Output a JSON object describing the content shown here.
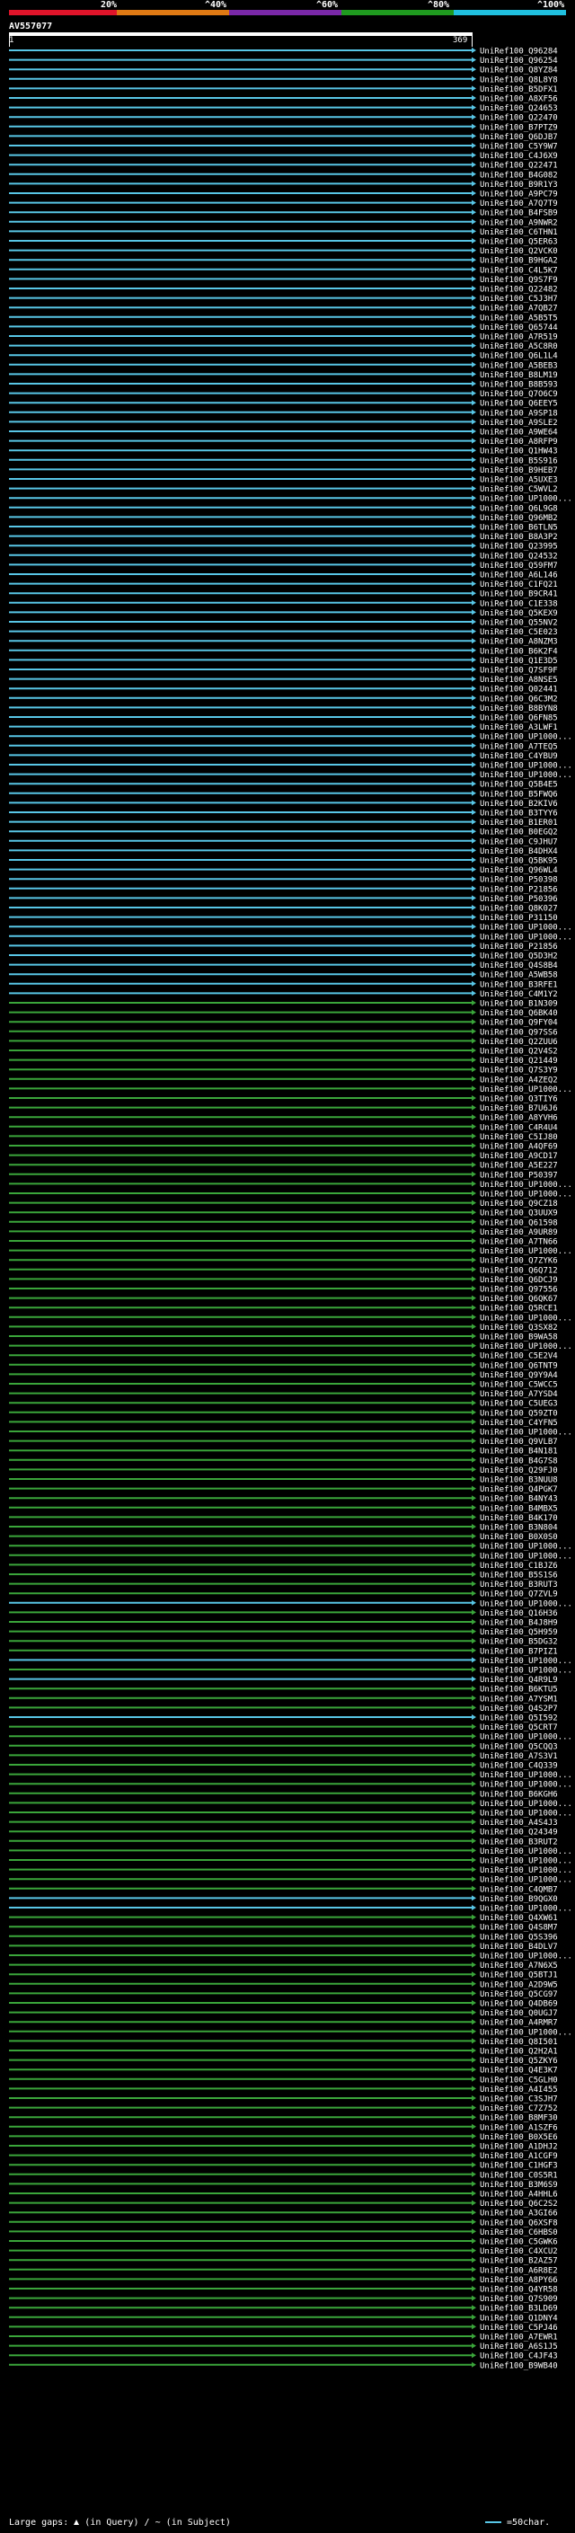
{
  "colors": {
    "scale_segments": [
      "#e0142a",
      "#e07a14",
      "#7a28a8",
      "#1f9a1f",
      "#20c0e0"
    ],
    "hit_high": "#58c6e6",
    "hit_mid": "#3aa53a",
    "marker": "#ffffff",
    "label": "#ffffff"
  },
  "scale": {
    "labels": [
      "20%",
      "^40%",
      "^60%",
      "^80%",
      "^100%"
    ]
  },
  "query": {
    "title": "AV557077",
    "start": "1",
    "end": "369"
  },
  "chart_data": {
    "type": "alignment-overview",
    "query_length": 369,
    "hits": [
      {
        "id": "UniRef100_Q96284",
        "identity": "high"
      },
      {
        "id": "UniRef100_Q96254",
        "identity": "high"
      },
      {
        "id": "UniRef100_Q8YZ84",
        "identity": "high"
      },
      {
        "id": "UniRef100_Q8L8Y8",
        "identity": "high"
      },
      {
        "id": "UniRef100_B5DFX1",
        "identity": "high"
      },
      {
        "id": "UniRef100_A8XF56",
        "identity": "high"
      },
      {
        "id": "UniRef100_Q24653",
        "identity": "high"
      },
      {
        "id": "UniRef100_Q22470",
        "identity": "high"
      },
      {
        "id": "UniRef100_B7PTZ9",
        "identity": "high"
      },
      {
        "id": "UniRef100_Q6DJB7",
        "identity": "high"
      },
      {
        "id": "UniRef100_C5Y9W7",
        "identity": "high"
      },
      {
        "id": "UniRef100_C4J6X9",
        "identity": "high"
      },
      {
        "id": "UniRef100_Q22471",
        "identity": "high"
      },
      {
        "id": "UniRef100_B4G082",
        "identity": "high"
      },
      {
        "id": "UniRef100_B9R1Y3",
        "identity": "high"
      },
      {
        "id": "UniRef100_A9PC79",
        "identity": "high"
      },
      {
        "id": "UniRef100_A7Q7T9",
        "identity": "high"
      },
      {
        "id": "UniRef100_B4FSB9",
        "identity": "high"
      },
      {
        "id": "UniRef100_A9NWR2",
        "identity": "high"
      },
      {
        "id": "UniRef100_C6THN1",
        "identity": "high"
      },
      {
        "id": "UniRef100_Q5ER63",
        "identity": "high"
      },
      {
        "id": "UniRef100_Q2VCK0",
        "identity": "high"
      },
      {
        "id": "UniRef100_B9HGA2",
        "identity": "high"
      },
      {
        "id": "UniRef100_C4L5K7",
        "identity": "high"
      },
      {
        "id": "UniRef100_Q9S7F9",
        "identity": "high"
      },
      {
        "id": "UniRef100_Q22482",
        "identity": "high"
      },
      {
        "id": "UniRef100_C5J3H7",
        "identity": "high"
      },
      {
        "id": "UniRef100_A7QB27",
        "identity": "high"
      },
      {
        "id": "UniRef100_A5B5T5",
        "identity": "high"
      },
      {
        "id": "UniRef100_Q65744",
        "identity": "high"
      },
      {
        "id": "UniRef100_A7R519",
        "identity": "high"
      },
      {
        "id": "UniRef100_A5C8R0",
        "identity": "high"
      },
      {
        "id": "UniRef100_Q6L1L4",
        "identity": "high"
      },
      {
        "id": "UniRef100_A5BEB3",
        "identity": "high"
      },
      {
        "id": "UniRef100_B8LM19",
        "identity": "high"
      },
      {
        "id": "UniRef100_B8B593",
        "identity": "high"
      },
      {
        "id": "UniRef100_Q7O6C9",
        "identity": "high"
      },
      {
        "id": "UniRef100_Q6EEY5",
        "identity": "high"
      },
      {
        "id": "UniRef100_A9SP18",
        "identity": "high"
      },
      {
        "id": "UniRef100_A9SLE2",
        "identity": "high"
      },
      {
        "id": "UniRef100_A9WE64",
        "identity": "high"
      },
      {
        "id": "UniRef100_A8RFP9",
        "identity": "high"
      },
      {
        "id": "UniRef100_Q1HW43",
        "identity": "high"
      },
      {
        "id": "UniRef100_B5S916",
        "identity": "high"
      },
      {
        "id": "UniRef100_B9HEB7",
        "identity": "high"
      },
      {
        "id": "UniRef100_A5UXE3",
        "identity": "high"
      },
      {
        "id": "UniRef100_C5WVL2",
        "identity": "high"
      },
      {
        "id": "UniRef100_UP1000...",
        "identity": "high"
      },
      {
        "id": "UniRef100_Q6L9G8",
        "identity": "high"
      },
      {
        "id": "UniRef100_Q96MB2",
        "identity": "high"
      },
      {
        "id": "UniRef100_B6TLN5",
        "identity": "high"
      },
      {
        "id": "UniRef100_B8A3P2",
        "identity": "high"
      },
      {
        "id": "UniRef100_Q23995",
        "identity": "high"
      },
      {
        "id": "UniRef100_Q24532",
        "identity": "high"
      },
      {
        "id": "UniRef100_Q59FM7",
        "identity": "high"
      },
      {
        "id": "UniRef100_A6L146",
        "identity": "high"
      },
      {
        "id": "UniRef100_C1FQ21",
        "identity": "high"
      },
      {
        "id": "UniRef100_B9CR41",
        "identity": "high"
      },
      {
        "id": "UniRef100_C1E338",
        "identity": "high"
      },
      {
        "id": "UniRef100_Q5KEX9",
        "identity": "high"
      },
      {
        "id": "UniRef100_Q55NV2",
        "identity": "high"
      },
      {
        "id": "UniRef100_C5E023",
        "identity": "high"
      },
      {
        "id": "UniRef100_A8NZM3",
        "identity": "high"
      },
      {
        "id": "UniRef100_B6K2F4",
        "identity": "high"
      },
      {
        "id": "UniRef100_Q1E3D5",
        "identity": "high"
      },
      {
        "id": "UniRef100_Q7SF9F",
        "identity": "high"
      },
      {
        "id": "UniRef100_A8NSE5",
        "identity": "high"
      },
      {
        "id": "UniRef100_Q02441",
        "identity": "high"
      },
      {
        "id": "UniRef100_Q6C3M2",
        "identity": "high"
      },
      {
        "id": "UniRef100_B8BYN8",
        "identity": "high"
      },
      {
        "id": "UniRef100_Q6FN85",
        "identity": "high"
      },
      {
        "id": "UniRef100_A3LWF1",
        "identity": "high"
      },
      {
        "id": "UniRef100_UP1000...",
        "identity": "high"
      },
      {
        "id": "UniRef100_A7TEQ5",
        "identity": "high"
      },
      {
        "id": "UniRef100_C4YBU9",
        "identity": "high"
      },
      {
        "id": "UniRef100_UP1000...",
        "identity": "high"
      },
      {
        "id": "UniRef100_UP1000...",
        "identity": "high"
      },
      {
        "id": "UniRef100_Q5B4E5",
        "identity": "high"
      },
      {
        "id": "UniRef100_B5FWQ6",
        "identity": "high"
      },
      {
        "id": "UniRef100_B2KIV6",
        "identity": "high"
      },
      {
        "id": "UniRef100_B3TYY6",
        "identity": "high"
      },
      {
        "id": "UniRef100_B1ER01",
        "identity": "high"
      },
      {
        "id": "UniRef100_B0EGQ2",
        "identity": "high"
      },
      {
        "id": "UniRef100_C9JHU7",
        "identity": "high"
      },
      {
        "id": "UniRef100_B4DHX4",
        "identity": "high"
      },
      {
        "id": "UniRef100_Q5BK95",
        "identity": "high"
      },
      {
        "id": "UniRef100_Q96WL4",
        "identity": "high"
      },
      {
        "id": "UniRef100_P50398",
        "identity": "high"
      },
      {
        "id": "UniRef100_P21856",
        "identity": "high"
      },
      {
        "id": "UniRef100_P50396",
        "identity": "high"
      },
      {
        "id": "UniRef100_Q8K027",
        "identity": "high"
      },
      {
        "id": "UniRef100_P31150",
        "identity": "high"
      },
      {
        "id": "UniRef100_UP1000...",
        "identity": "high"
      },
      {
        "id": "UniRef100_UP1000...",
        "identity": "high"
      },
      {
        "id": "UniRef100_P21856",
        "identity": "high"
      },
      {
        "id": "UniRef100_Q5D3H2",
        "identity": "high"
      },
      {
        "id": "UniRef100_Q4S8B4",
        "identity": "high"
      },
      {
        "id": "UniRef100_A5WB58",
        "identity": "high"
      },
      {
        "id": "UniRef100_B3RFE1",
        "identity": "high"
      },
      {
        "id": "UniRef100_C4M1Y2",
        "identity": "high"
      },
      {
        "id": "UniRef100_B1N309",
        "identity": "mid"
      },
      {
        "id": "UniRef100_Q6BK40",
        "identity": "mid"
      },
      {
        "id": "UniRef100_Q9FY04",
        "identity": "mid"
      },
      {
        "id": "UniRef100_Q97SS6",
        "identity": "mid"
      },
      {
        "id": "UniRef100_Q2ZUU6",
        "identity": "mid"
      },
      {
        "id": "UniRef100_Q2V4S2",
        "identity": "mid"
      },
      {
        "id": "UniRef100_Q21449",
        "identity": "mid"
      },
      {
        "id": "UniRef100_Q7S3Y9",
        "identity": "mid"
      },
      {
        "id": "UniRef100_A4ZEQ2",
        "identity": "mid"
      },
      {
        "id": "UniRef100_UP1000...",
        "identity": "mid"
      },
      {
        "id": "UniRef100_Q3TIY6",
        "identity": "mid"
      },
      {
        "id": "UniRef100_B7U6J6",
        "identity": "mid"
      },
      {
        "id": "UniRef100_A8YVH6",
        "identity": "mid"
      },
      {
        "id": "UniRef100_C4R4U4",
        "identity": "mid"
      },
      {
        "id": "UniRef100_C5IJ80",
        "identity": "mid"
      },
      {
        "id": "UniRef100_A4QF69",
        "identity": "mid"
      },
      {
        "id": "UniRef100_A9CD17",
        "identity": "mid"
      },
      {
        "id": "UniRef100_A5E227",
        "identity": "mid"
      },
      {
        "id": "UniRef100_P50397",
        "identity": "mid"
      },
      {
        "id": "UniRef100_UP1000...",
        "identity": "mid"
      },
      {
        "id": "UniRef100_UP1000...",
        "identity": "mid"
      },
      {
        "id": "UniRef100_Q9CZ18",
        "identity": "mid"
      },
      {
        "id": "UniRef100_Q3UUX9",
        "identity": "mid"
      },
      {
        "id": "UniRef100_Q61598",
        "identity": "mid"
      },
      {
        "id": "UniRef100_A9UR89",
        "identity": "mid"
      },
      {
        "id": "UniRef100_A7TN66",
        "identity": "mid"
      },
      {
        "id": "UniRef100_UP1000...",
        "identity": "mid"
      },
      {
        "id": "UniRef100_Q7ZYK6",
        "identity": "mid"
      },
      {
        "id": "UniRef100_Q6Q712",
        "identity": "mid"
      },
      {
        "id": "UniRef100_Q6DCJ9",
        "identity": "mid"
      },
      {
        "id": "UniRef100_Q97556",
        "identity": "mid"
      },
      {
        "id": "UniRef100_Q6QK67",
        "identity": "mid"
      },
      {
        "id": "UniRef100_Q5RCE1",
        "identity": "mid"
      },
      {
        "id": "UniRef100_UP1000...",
        "identity": "mid"
      },
      {
        "id": "UniRef100_Q3SX82",
        "identity": "mid"
      },
      {
        "id": "UniRef100_B9WA58",
        "identity": "mid"
      },
      {
        "id": "UniRef100_UP1000...",
        "identity": "mid"
      },
      {
        "id": "UniRef100_C5E2V4",
        "identity": "mid"
      },
      {
        "id": "UniRef100_Q6TNT9",
        "identity": "mid"
      },
      {
        "id": "UniRef100_Q9Y9A4",
        "identity": "mid"
      },
      {
        "id": "UniRef100_C5WCC5",
        "identity": "mid"
      },
      {
        "id": "UniRef100_A7YSD4",
        "identity": "mid"
      },
      {
        "id": "UniRef100_C5UEG3",
        "identity": "mid"
      },
      {
        "id": "UniRef100_Q59ZT0",
        "identity": "mid"
      },
      {
        "id": "UniRef100_C4YFN5",
        "identity": "mid"
      },
      {
        "id": "UniRef100_UP1000...",
        "identity": "mid"
      },
      {
        "id": "UniRef100_Q9VLB7",
        "identity": "mid"
      },
      {
        "id": "UniRef100_B4N181",
        "identity": "mid"
      },
      {
        "id": "UniRef100_B4G7S8",
        "identity": "mid"
      },
      {
        "id": "UniRef100_Q29FJ0",
        "identity": "mid"
      },
      {
        "id": "UniRef100_B3NUU8",
        "identity": "mid"
      },
      {
        "id": "UniRef100_Q4PGK7",
        "identity": "mid"
      },
      {
        "id": "UniRef100_B4NY43",
        "identity": "mid"
      },
      {
        "id": "UniRef100_B4MBX5",
        "identity": "mid"
      },
      {
        "id": "UniRef100_B4K170",
        "identity": "mid"
      },
      {
        "id": "UniRef100_B3N804",
        "identity": "mid"
      },
      {
        "id": "UniRef100_B0X0S0",
        "identity": "mid"
      },
      {
        "id": "UniRef100_UP1000...",
        "identity": "mid"
      },
      {
        "id": "UniRef100_UP1000...",
        "identity": "mid"
      },
      {
        "id": "UniRef100_C1BJZ6",
        "identity": "mid"
      },
      {
        "id": "UniRef100_B5S1S6",
        "identity": "mid"
      },
      {
        "id": "UniRef100_B3RUT3",
        "identity": "mid"
      },
      {
        "id": "UniRef100_Q7ZVL9",
        "identity": "mid"
      },
      {
        "id": "UniRef100_UP1000...",
        "identity": "high"
      },
      {
        "id": "UniRef100_Q16H36",
        "identity": "mid"
      },
      {
        "id": "UniRef100_B4J8H9",
        "identity": "mid"
      },
      {
        "id": "UniRef100_Q5H959",
        "identity": "mid"
      },
      {
        "id": "UniRef100_B5DG32",
        "identity": "mid"
      },
      {
        "id": "UniRef100_B7PIZ1",
        "identity": "mid"
      },
      {
        "id": "UniRef100_UP1000...",
        "identity": "high"
      },
      {
        "id": "UniRef100_UP1000...",
        "identity": "mid"
      },
      {
        "id": "UniRef100_Q4R9L9",
        "identity": "high"
      },
      {
        "id": "UniRef100_B6KTU5",
        "identity": "mid"
      },
      {
        "id": "UniRef100_A7YSM1",
        "identity": "mid"
      },
      {
        "id": "UniRef100_Q4S2P7",
        "identity": "mid"
      },
      {
        "id": "UniRef100_Q5I592",
        "identity": "high"
      },
      {
        "id": "UniRef100_Q5CRT7",
        "identity": "mid"
      },
      {
        "id": "UniRef100_UP1000...",
        "identity": "mid"
      },
      {
        "id": "UniRef100_Q5CQQ3",
        "identity": "mid"
      },
      {
        "id": "UniRef100_A7S3V1",
        "identity": "mid"
      },
      {
        "id": "UniRef100_C4Q339",
        "identity": "mid"
      },
      {
        "id": "UniRef100_UP1000...",
        "identity": "mid"
      },
      {
        "id": "UniRef100_UP1000...",
        "identity": "mid"
      },
      {
        "id": "UniRef100_B6KGH6",
        "identity": "mid"
      },
      {
        "id": "UniRef100_UP1000...",
        "identity": "mid"
      },
      {
        "id": "UniRef100_UP1000...",
        "identity": "mid"
      },
      {
        "id": "UniRef100_A4S4J3",
        "identity": "mid"
      },
      {
        "id": "UniRef100_Q24349",
        "identity": "mid"
      },
      {
        "id": "UniRef100_B3RUT2",
        "identity": "mid"
      },
      {
        "id": "UniRef100_UP1000...",
        "identity": "mid"
      },
      {
        "id": "UniRef100_UP1000...",
        "identity": "mid"
      },
      {
        "id": "UniRef100_UP1000...",
        "identity": "mid"
      },
      {
        "id": "UniRef100_UP1000...",
        "identity": "mid"
      },
      {
        "id": "UniRef100_C4QMB7",
        "identity": "mid"
      },
      {
        "id": "UniRef100_B9QGX0",
        "identity": "high"
      },
      {
        "id": "UniRef100_UP1000...",
        "identity": "high"
      },
      {
        "id": "UniRef100_Q4XW61",
        "identity": "mid"
      },
      {
        "id": "UniRef100_Q4S8M7",
        "identity": "mid"
      },
      {
        "id": "UniRef100_Q5S396",
        "identity": "mid"
      },
      {
        "id": "UniRef100_B4DLV7",
        "identity": "mid"
      },
      {
        "id": "UniRef100_UP1000...",
        "identity": "mid"
      },
      {
        "id": "UniRef100_A7N6X5",
        "identity": "mid"
      },
      {
        "id": "UniRef100_Q5BTJ1",
        "identity": "mid"
      },
      {
        "id": "UniRef100_A2D9W5",
        "identity": "mid"
      },
      {
        "id": "UniRef100_Q5CG97",
        "identity": "mid"
      },
      {
        "id": "UniRef100_Q4DB69",
        "identity": "mid"
      },
      {
        "id": "UniRef100_Q0UGJ7",
        "identity": "mid"
      },
      {
        "id": "UniRef100_A4RMR7",
        "identity": "mid"
      },
      {
        "id": "UniRef100_UP1000...",
        "identity": "mid"
      },
      {
        "id": "UniRef100_Q8I501",
        "identity": "mid"
      },
      {
        "id": "UniRef100_Q2H2A1",
        "identity": "mid"
      },
      {
        "id": "UniRef100_Q5ZKY6",
        "identity": "mid"
      },
      {
        "id": "UniRef100_Q4E3K7",
        "identity": "mid"
      },
      {
        "id": "UniRef100_C5GLH0",
        "identity": "mid"
      },
      {
        "id": "UniRef100_A4I455",
        "identity": "mid"
      },
      {
        "id": "UniRef100_C3SJH7",
        "identity": "mid"
      },
      {
        "id": "UniRef100_C7Z752",
        "identity": "mid"
      },
      {
        "id": "UniRef100_B8MF30",
        "identity": "mid"
      },
      {
        "id": "UniRef100_A1SZF6",
        "identity": "mid"
      },
      {
        "id": "UniRef100_B0X5E6",
        "identity": "mid"
      },
      {
        "id": "UniRef100_A1DHJ2",
        "identity": "mid"
      },
      {
        "id": "UniRef100_A1CGF9",
        "identity": "mid"
      },
      {
        "id": "UniRef100_C1HGF3",
        "identity": "mid"
      },
      {
        "id": "UniRef100_C0S5R1",
        "identity": "mid"
      },
      {
        "id": "UniRef100_B3M6S9",
        "identity": "mid"
      },
      {
        "id": "UniRef100_A4HHL6",
        "identity": "mid"
      },
      {
        "id": "UniRef100_Q6C2S2",
        "identity": "mid"
      },
      {
        "id": "UniRef100_A3GI66",
        "identity": "mid"
      },
      {
        "id": "UniRef100_Q6XSF8",
        "identity": "mid"
      },
      {
        "id": "UniRef100_C6HBS0",
        "identity": "mid"
      },
      {
        "id": "UniRef100_C5GWK6",
        "identity": "mid"
      },
      {
        "id": "UniRef100_C4XCU2",
        "identity": "mid"
      },
      {
        "id": "UniRef100_B2AZ57",
        "identity": "mid"
      },
      {
        "id": "UniRef100_A6R8E2",
        "identity": "mid"
      },
      {
        "id": "UniRef100_A8PY66",
        "identity": "mid"
      },
      {
        "id": "UniRef100_Q4YR58",
        "identity": "mid"
      },
      {
        "id": "UniRef100_Q7S909",
        "identity": "mid"
      },
      {
        "id": "UniRef100_B3LD69",
        "identity": "mid"
      },
      {
        "id": "UniRef100_Q1DNY4",
        "identity": "mid"
      },
      {
        "id": "UniRef100_C5PJ46",
        "identity": "mid"
      },
      {
        "id": "UniRef100_A7EWR1",
        "identity": "mid"
      },
      {
        "id": "UniRef100_A6S1J5",
        "identity": "mid"
      },
      {
        "id": "UniRef100_C4JF43",
        "identity": "mid"
      },
      {
        "id": "UniRef100_B9WB40",
        "identity": "mid"
      }
    ]
  },
  "legend": {
    "prefix": "Large gaps:",
    "in_query": "(in Query)",
    "separator": "/",
    "in_subject": "(in Subject)",
    "scale_note": "=50char."
  }
}
